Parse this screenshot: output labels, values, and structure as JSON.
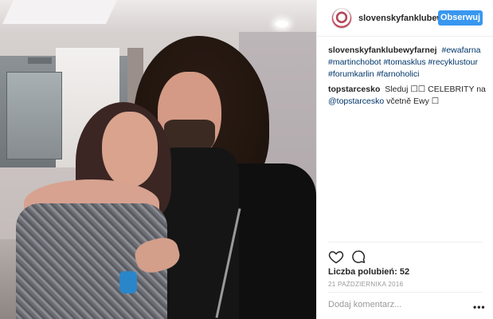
{
  "header": {
    "username": "slovenskyfanklubew",
    "follow_label": "Obserwuj"
  },
  "comments": [
    {
      "user": "slovenskyfanklubewyfarnej",
      "tags": [
        "#ewafarna",
        "#martinchobot",
        "#tomasklus",
        "#recyklustour",
        "#forumkarlin",
        "#farnoholici"
      ]
    },
    {
      "user": "topstarcesko",
      "text": "Sleduj ☐☐ CELEBRITY na",
      "mention": "@topstarcesko",
      "text_after": "včetně Ewy ☐"
    }
  ],
  "actions": {
    "like_icon": "heart-icon",
    "comment_icon": "comment-icon"
  },
  "likes_label": "Liczba polubień: 52",
  "date": "21 PAŹDZIERNIKA 2016",
  "add_comment_placeholder": "Dodaj komentarz...",
  "more_label": "•••",
  "colors": {
    "follow_button": "#3897f0",
    "hashtag": "#003569",
    "secondary_text": "#999999"
  }
}
